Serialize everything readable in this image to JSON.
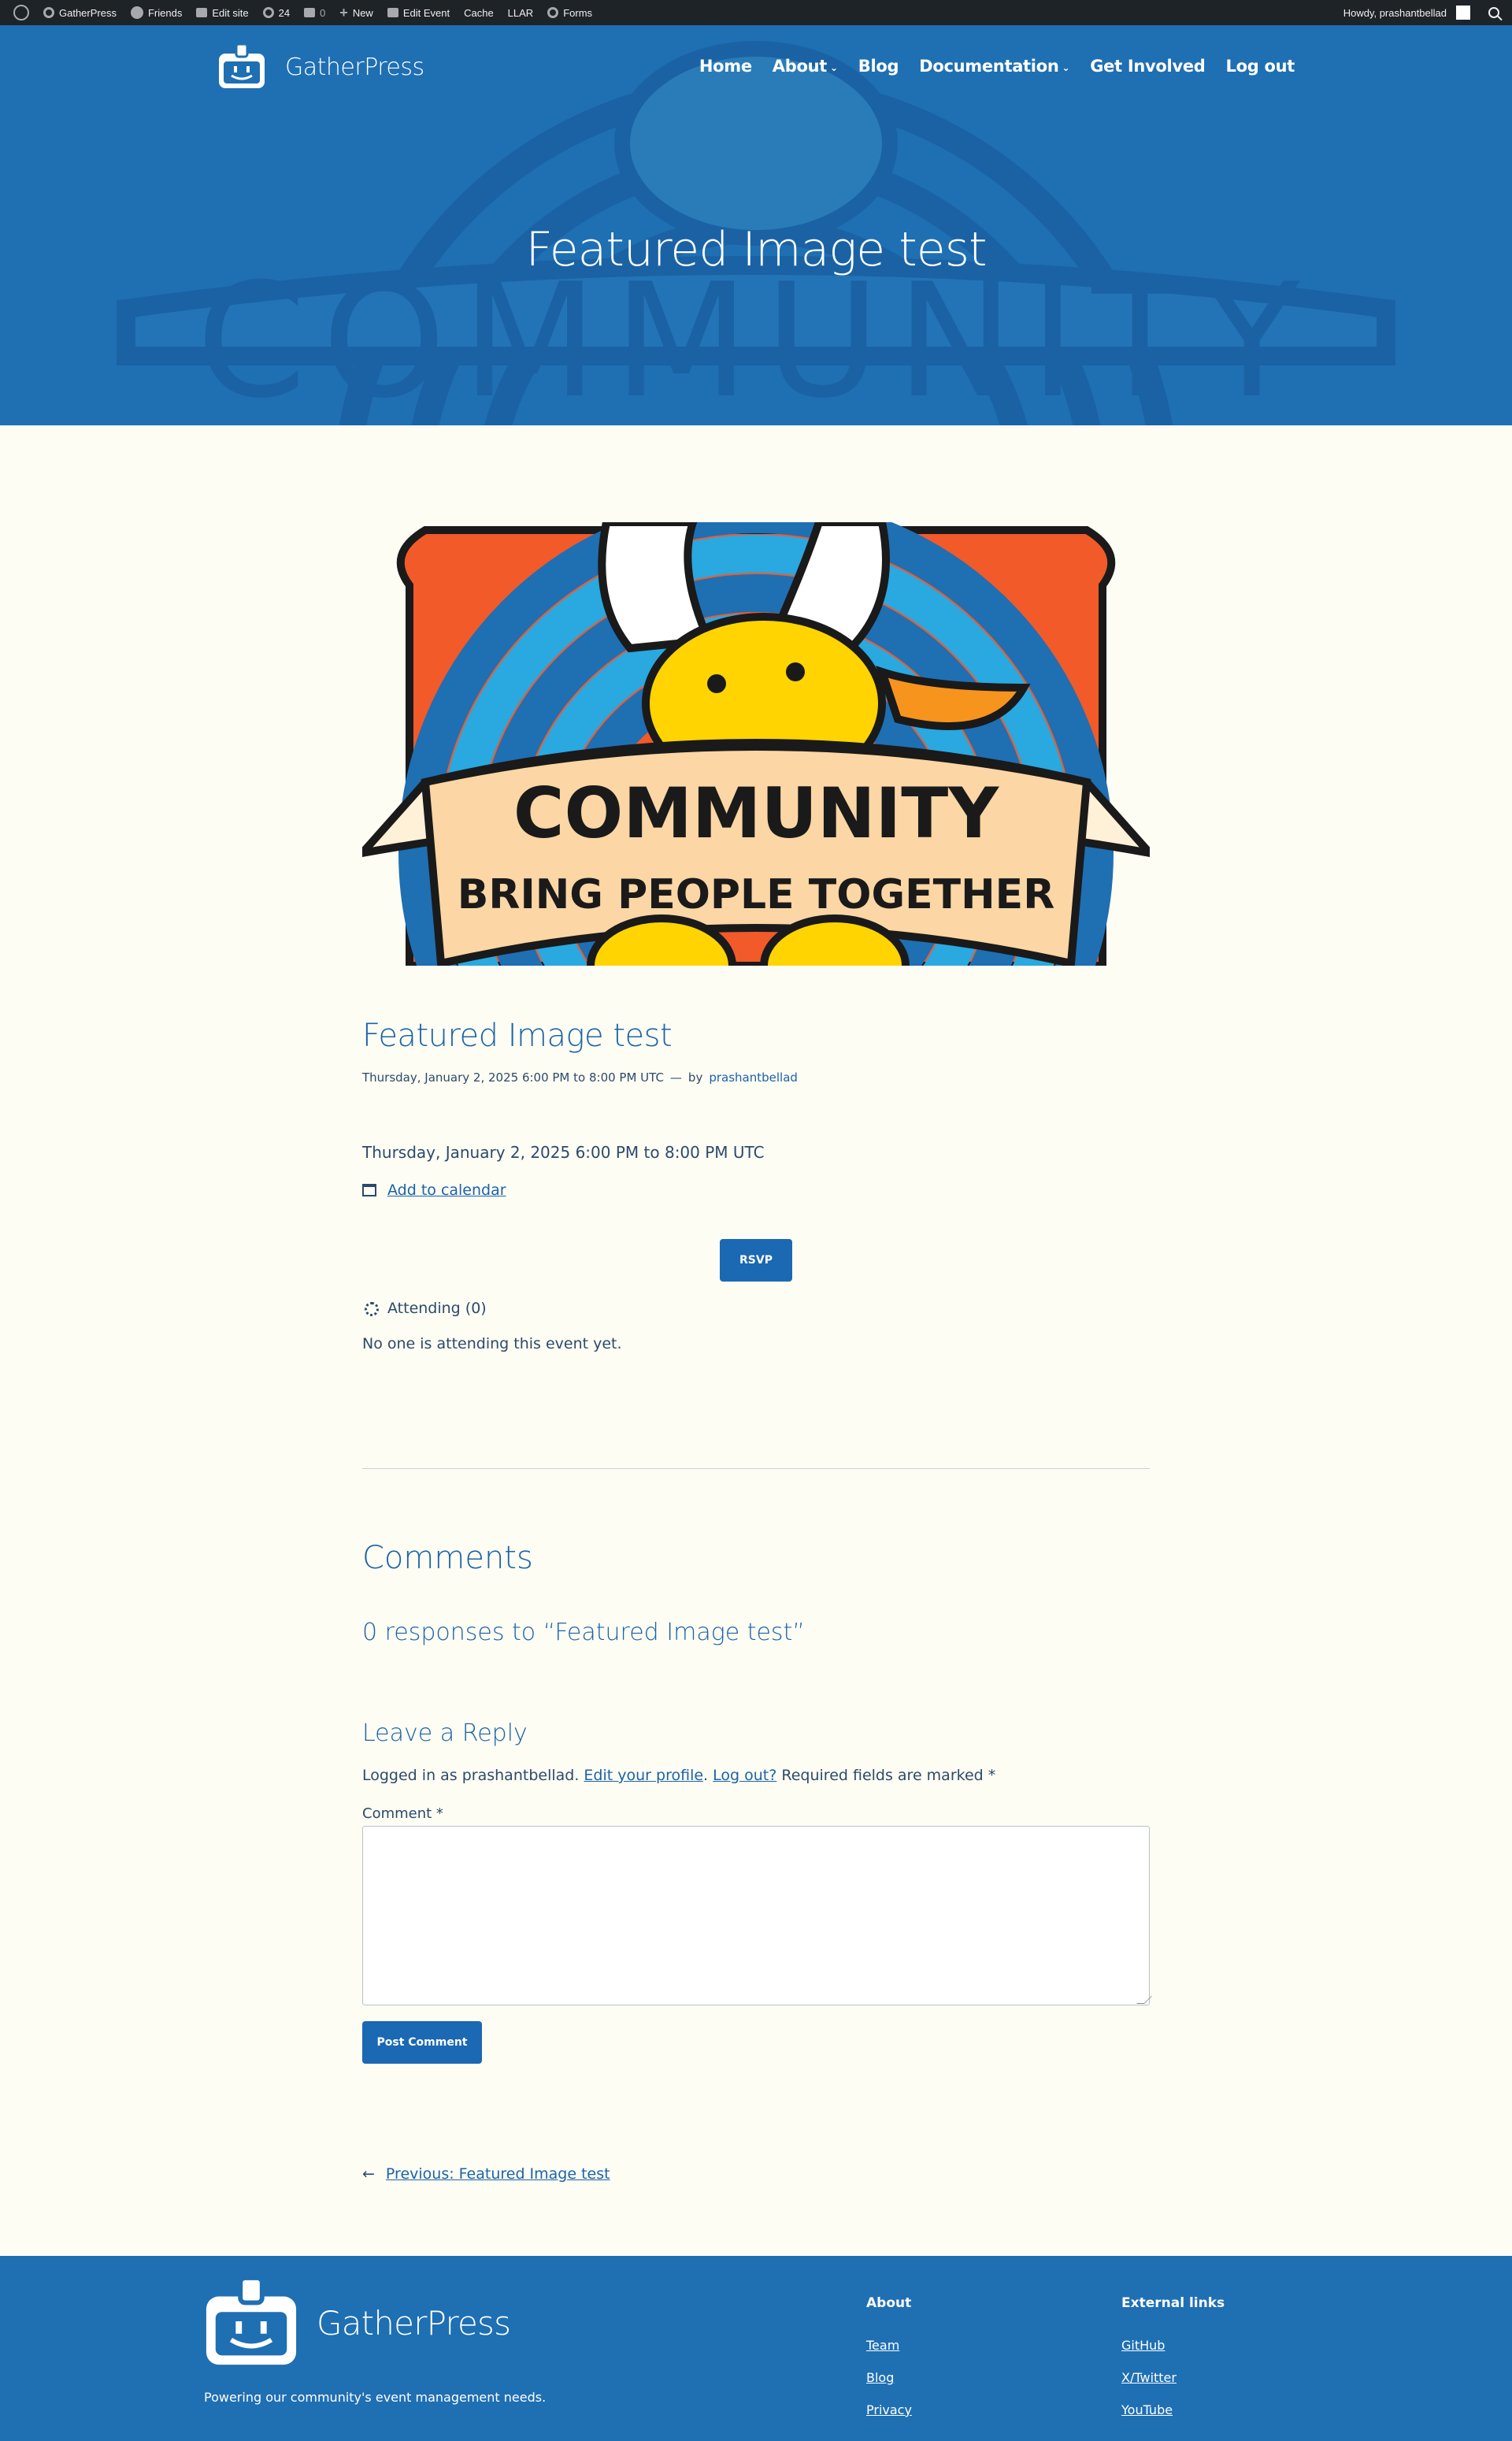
{
  "admin_bar": {
    "site_name": "GatherPress",
    "friends": "Friends",
    "edit_site": "Edit site",
    "updates_count": "24",
    "comments_count": "0",
    "new": "New",
    "edit_event": "Edit Event",
    "cache": "Cache",
    "llar": "LLAR",
    "forms": "Forms",
    "greeting": "Howdy, prashantbellad"
  },
  "header": {
    "site_title": "GatherPress",
    "nav": [
      {
        "label": "Home"
      },
      {
        "label": "About"
      },
      {
        "label": "Blog"
      },
      {
        "label": "Documentation"
      },
      {
        "label": "Get Involved"
      },
      {
        "label": "Log out"
      }
    ],
    "hero_title": "Featured Image test"
  },
  "featured_image": {
    "banner_line1": "COMMUNITY",
    "banner_line2": "BRING PEOPLE TOGETHER",
    "colors": {
      "orange": "#f25a29",
      "blue_dark": "#1f6fb3",
      "blue_light": "#2aa8e0",
      "yellow": "#ffd400",
      "peach": "#fcd6a4"
    }
  },
  "post": {
    "title": "Featured Image test",
    "meta_datetime": "Thursday, January 2, 2025 6:00 PM to 8:00 PM UTC",
    "meta_sep": "—",
    "meta_by": "by",
    "meta_author": "prashantbellad",
    "event_datetime": "Thursday, January 2, 2025 6:00 PM to 8:00 PM UTC",
    "add_to_calendar": "Add to calendar",
    "rsvp_label": "RSVP",
    "attending_label": "Attending (0)",
    "no_attendees": "No one is attending this event yet."
  },
  "comments": {
    "heading": "Comments",
    "responses": "0 responses to “Featured Image test”",
    "reply_heading": "Leave a Reply",
    "logged_in_prefix": "Logged in as prashantbellad.",
    "edit_profile": "Edit your profile",
    "log_out": "Log out?",
    "required_note": "Required fields are marked *",
    "comment_label": "Comment *",
    "comment_value": "",
    "post_button": "Post Comment"
  },
  "post_nav": {
    "arrow": "←",
    "previous": "Previous: Featured Image test"
  },
  "footer": {
    "site_title": "GatherPress",
    "tagline": "Powering our community's event management needs.",
    "about_heading": "About",
    "about_links": [
      "Team",
      "Blog",
      "Privacy"
    ],
    "external_heading": "External links",
    "external_links": [
      "GitHub",
      "X/Twitter",
      "YouTube"
    ]
  },
  "theme": {
    "primary": "#1b68b3",
    "admin_bar": "#1d2327",
    "page_bg": "#fdfdf4"
  }
}
